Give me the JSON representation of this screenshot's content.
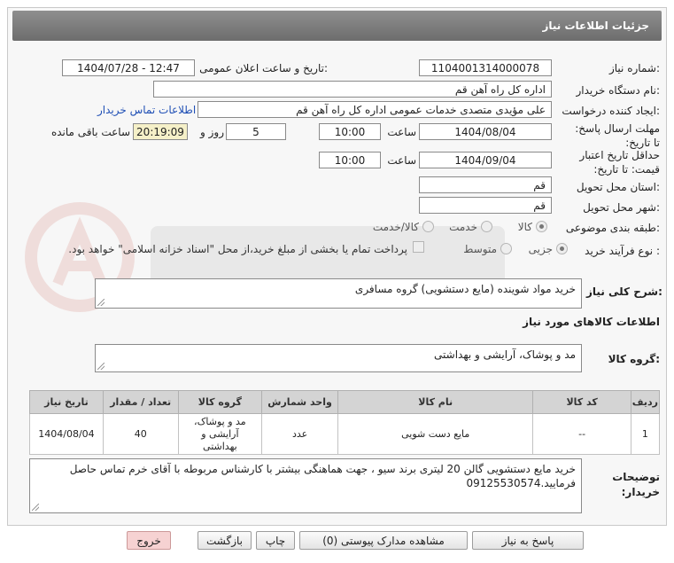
{
  "header": {
    "title": "جزئیات اطلاعات نیاز"
  },
  "fields": {
    "need_number": {
      "label": "شماره نیاز:",
      "value": "1104001314000078"
    },
    "announce_datetime": {
      "label": "تاریخ و ساعت اعلان عمومی:",
      "value": "1404/07/28 - 12:47"
    },
    "buyer_org": {
      "label": "نام دستگاه خریدار:",
      "value": "اداره کل  راه آهن قم"
    },
    "requester": {
      "label": "ایجاد کننده درخواست:",
      "value": "علی مؤیدی متصدی خدمات عمومی اداره کل  راه آهن قم"
    },
    "contact_link": "اطلاعات تماس خریدار",
    "deadline": {
      "label": "مهلت ارسال پاسخ: تا تاریخ:",
      "date": "1404/08/04",
      "time_label": "ساعت",
      "time": "10:00",
      "days": "5",
      "days_label": "روز و",
      "remaining": "20:19:09",
      "remaining_label": "ساعت باقی مانده"
    },
    "price_validity": {
      "label": "حداقل تاریخ اعتبار قیمت: تا تاریخ:",
      "date": "1404/09/04",
      "time_label": "ساعت",
      "time": "10:00"
    },
    "delivery_province": {
      "label": "استان محل تحویل:",
      "value": "قم"
    },
    "delivery_city": {
      "label": "شهر محل تحویل:",
      "value": "قم"
    },
    "category": {
      "label": "طبقه بندی موضوعی:",
      "options": [
        "کالا",
        "خدمت",
        "کالا/خدمت"
      ],
      "selected": "کالا"
    },
    "process_type": {
      "label": "نوع فرآیند خرید :",
      "options": [
        "جزیی",
        "متوسط"
      ],
      "selected": "جزیی",
      "payment_note": "پرداخت تمام یا بخشی از مبلغ خرید،از محل \"اسناد خزانه اسلامی\" خواهد بود."
    }
  },
  "summary": {
    "label": "شرح کلی نیاز:",
    "value": "خرید مواد شوینده (مایع دستشویی) گروه مسافری"
  },
  "goods_section_title": "اطلاعات کالاهای مورد نیاز",
  "goods_group": {
    "label": "گروه کالا:",
    "value": "مد و پوشاک، آرایشی و بهداشتی"
  },
  "table": {
    "headers": [
      "ردیف",
      "کد کالا",
      "نام کالا",
      "واحد شمارش",
      "گروه کالا",
      "تعداد / مقدار",
      "تاریخ نیاز"
    ],
    "rows": [
      [
        "1",
        "--",
        "مایع دست شویی",
        "عدد",
        "مد و پوشاک، آرایشی و بهداشتی",
        "40",
        "1404/08/04"
      ]
    ]
  },
  "buyer_notes": {
    "label": "توضیحات خریدار:",
    "value": "خرید مایع دستشویی گالن 20 لیتری برند سیو ، جهت هماهنگی بیشتر با کارشناس مربوطه با آقای خرم  تماس حاصل فرمایید.09125530574"
  },
  "buttons": {
    "reply": "پاسخ به نیاز",
    "view_docs": "مشاهده مدارک پیوستی (0)",
    "print": "چاپ",
    "back": "بازگشت",
    "exit": "خروج"
  }
}
